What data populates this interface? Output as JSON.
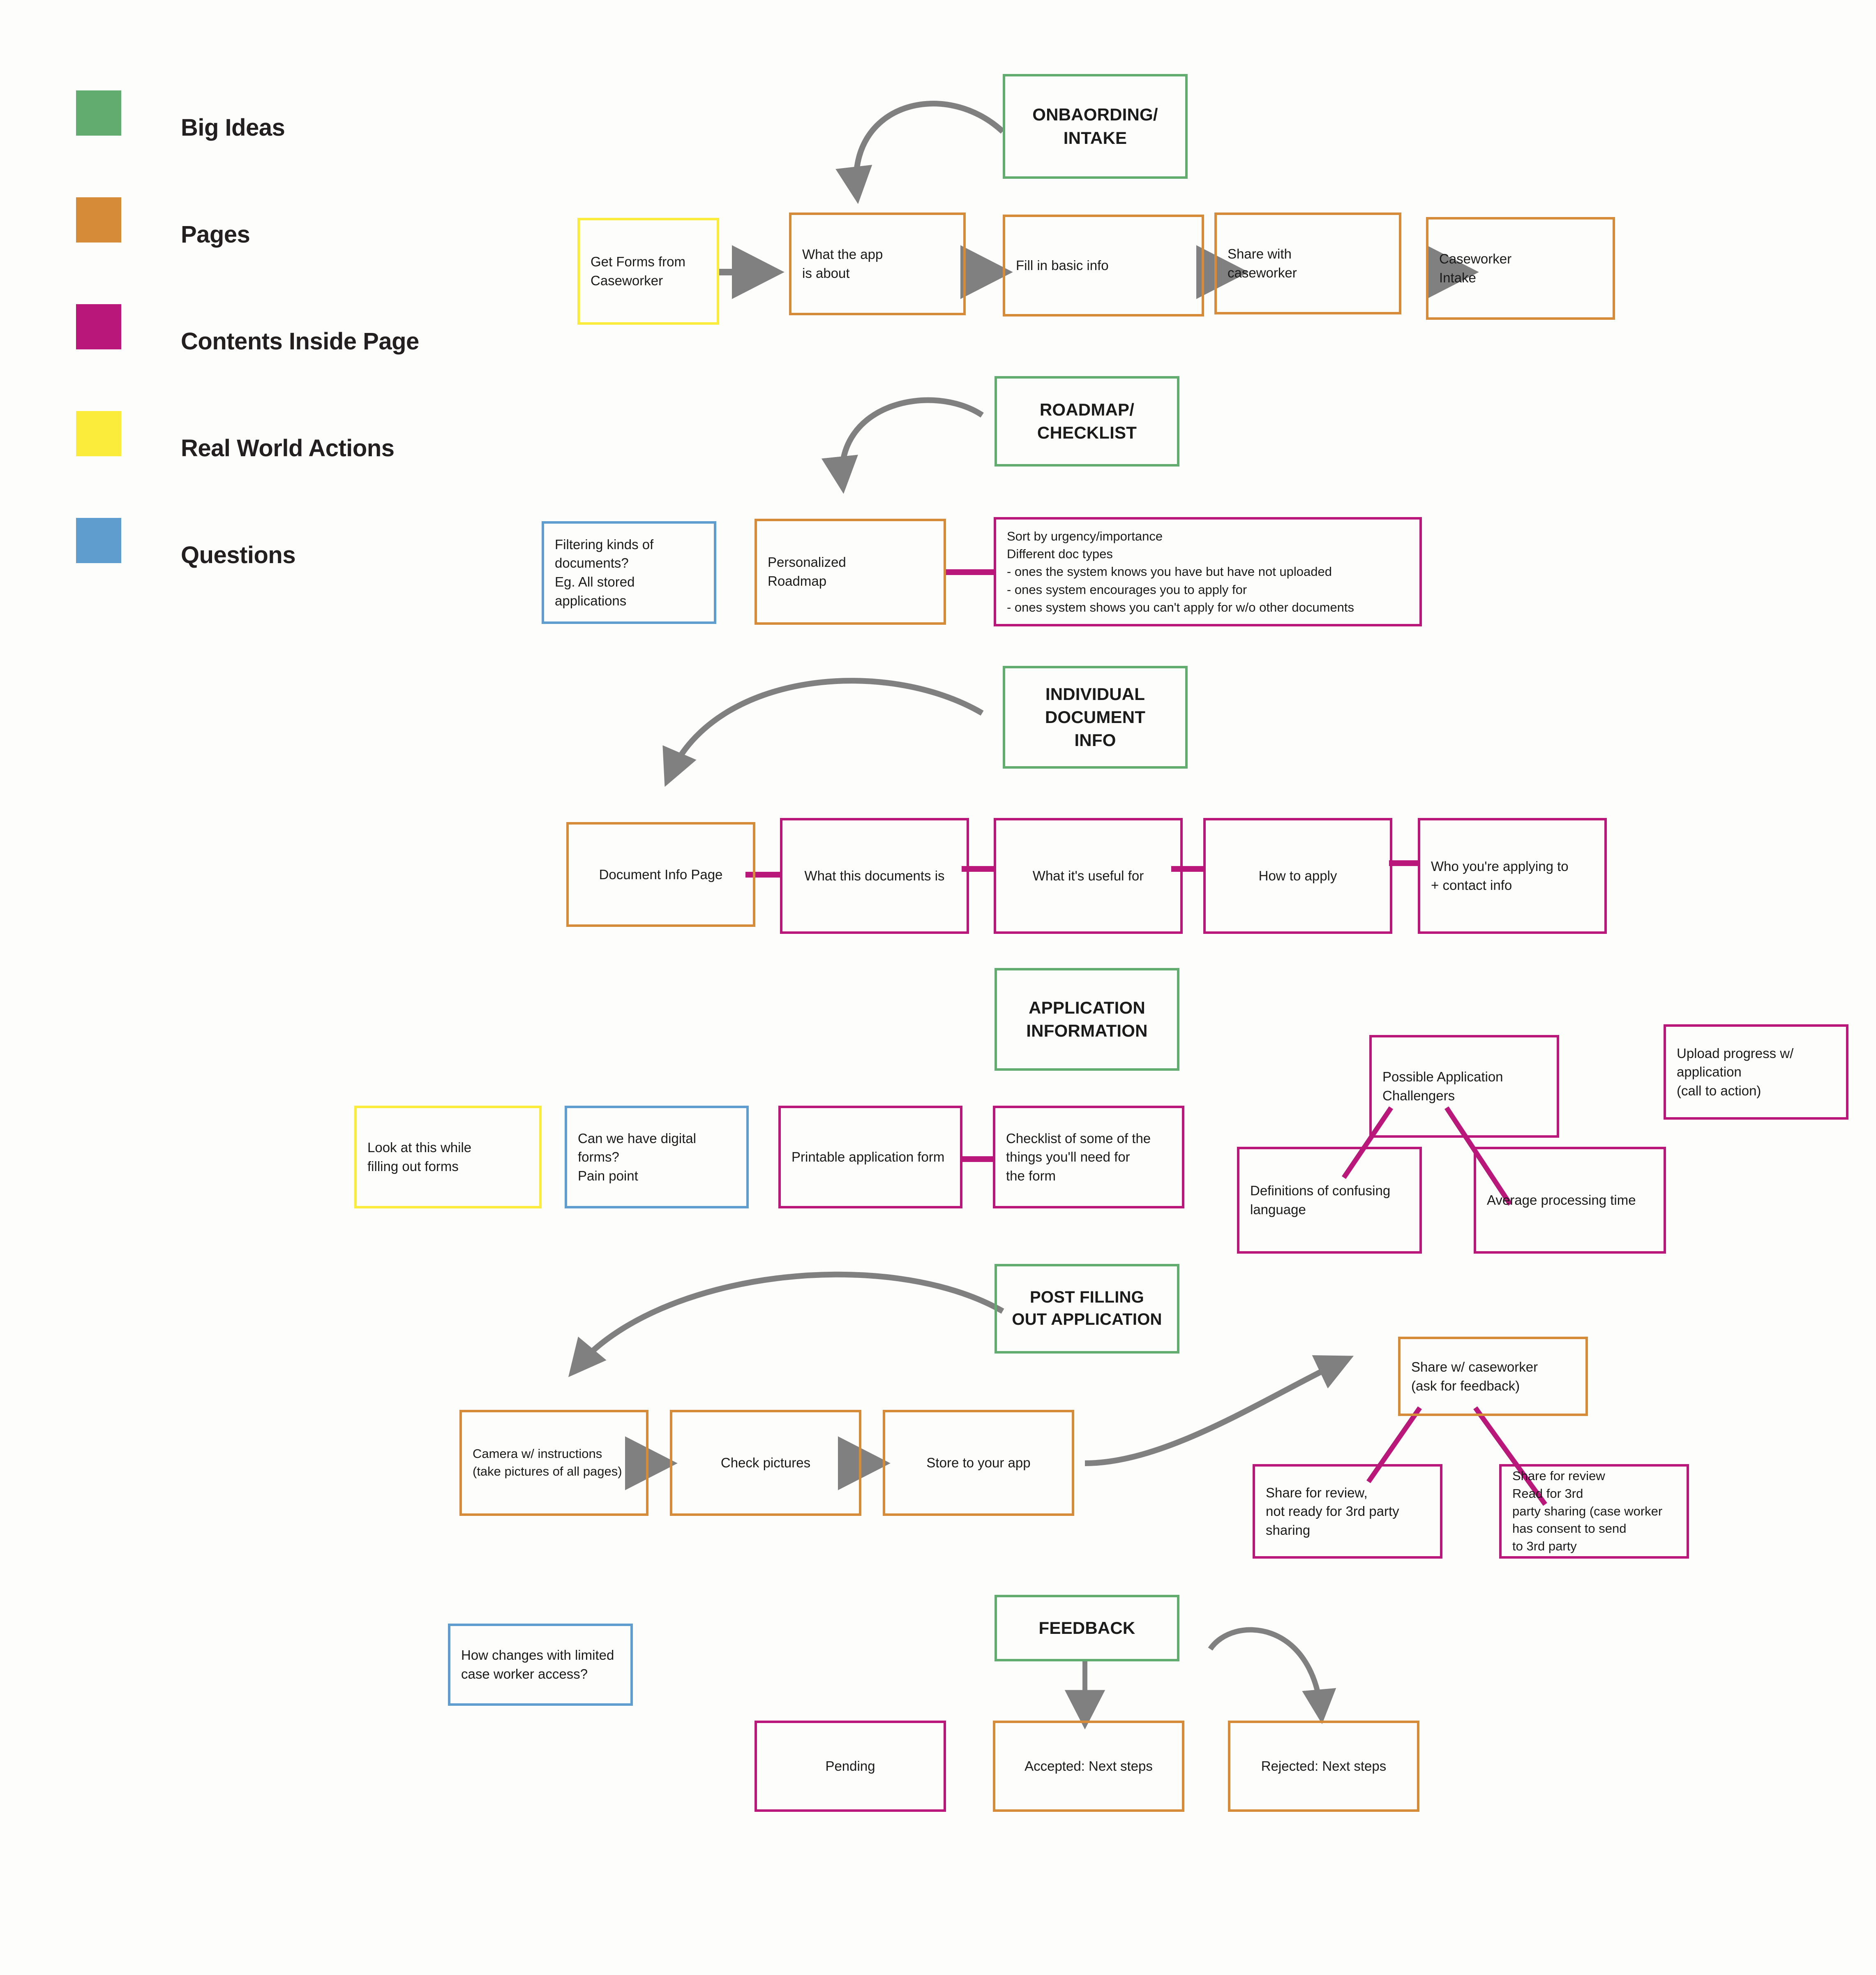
{
  "palette": {
    "green": "#63ac70",
    "orange": "#d68b38",
    "magenta": "#b91779",
    "yellow": "#fbeb3b",
    "blue": "#5e9dcd",
    "arrow_gray": "#808080",
    "text": "#1b1b1b"
  },
  "legend": {
    "items": [
      {
        "color_key": "green",
        "label": "Big Ideas"
      },
      {
        "color_key": "orange",
        "label": "Pages"
      },
      {
        "color_key": "magenta",
        "label": "Contents Inside Page"
      },
      {
        "color_key": "yellow",
        "label": "Real World Actions"
      },
      {
        "color_key": "blue",
        "label": "Questions"
      }
    ]
  },
  "sections": [
    {
      "id": "onboarding",
      "heading": "ONBAORDING/\nINTAKE",
      "nodes": [
        {
          "id": "get-forms-from-caseworker",
          "type": "yellow",
          "text": "Get Forms from\nCaseworker"
        },
        {
          "id": "what-the-app-is-about",
          "type": "orange",
          "text": "What the app\nis about"
        },
        {
          "id": "fill-in-basic-info",
          "type": "orange",
          "text": "Fill in basic info"
        },
        {
          "id": "share-with-caseworker",
          "type": "orange",
          "text": "Share with\ncaseworker"
        },
        {
          "id": "caseworker-intake",
          "type": "orange",
          "text": "Caseworker\nIntake"
        }
      ]
    },
    {
      "id": "roadmap",
      "heading": "ROADMAP/\nCHECKLIST",
      "nodes": [
        {
          "id": "filtering-kinds-of-documents",
          "type": "blue",
          "text": "Filtering kinds of\ndocuments?\nEg. All stored applications"
        },
        {
          "id": "personalized-roadmap",
          "type": "orange",
          "text": "Personalized\nRoadmap"
        },
        {
          "id": "sort-by-urgency",
          "type": "magenta",
          "text": "Sort by urgency/importance\nDifferent doc types\n- ones the system knows you have but have not uploaded\n- ones system encourages you to apply for\n- ones system shows you can't apply for w/o other documents"
        }
      ]
    },
    {
      "id": "individual-document-info",
      "heading": "INDIVIDUAL\nDOCUMENT\nINFO",
      "nodes": [
        {
          "id": "document-info-page",
          "type": "orange",
          "text": "Document Info Page"
        },
        {
          "id": "what-this-documents-is",
          "type": "magenta",
          "text": "What this documents is"
        },
        {
          "id": "what-its-useful-for",
          "type": "magenta",
          "text": "What it's useful for"
        },
        {
          "id": "how-to-apply",
          "type": "magenta",
          "text": "How to apply"
        },
        {
          "id": "who-youre-applying-to",
          "type": "magenta",
          "text": "Who you're applying to\n+ contact info"
        }
      ]
    },
    {
      "id": "application-information",
      "heading": "APPLICATION\nINFORMATION",
      "nodes": [
        {
          "id": "look-at-this-while-filling-out-forms",
          "type": "yellow",
          "text": "Look at this while\nfilling out forms"
        },
        {
          "id": "can-we-have-digital-forms",
          "type": "blue",
          "text": "Can we have digital forms?\nPain point"
        },
        {
          "id": "printable-application-form",
          "type": "magenta",
          "text": "Printable application form"
        },
        {
          "id": "checklist-of-things-for-form",
          "type": "magenta",
          "text": "Checklist of some of the\nthings you'll need for\nthe form"
        },
        {
          "id": "possible-application-challengers",
          "type": "magenta",
          "text": "Possible Application\nChallengers"
        },
        {
          "id": "definitions-of-confusing-language",
          "type": "magenta",
          "text": "Definitions of confusing\nlanguage"
        },
        {
          "id": "average-processing-time",
          "type": "magenta",
          "text": "Average processing time"
        },
        {
          "id": "upload-progress-w-application",
          "type": "magenta",
          "text": "Upload progress w/\napplication\n(call to action)"
        }
      ]
    },
    {
      "id": "post-filling-out-application",
      "heading": "POST FILLING\nOUT APPLICATION",
      "nodes": [
        {
          "id": "camera-with-instructions",
          "type": "orange",
          "text": "Camera w/ instructions\n(take pictures of all pages)"
        },
        {
          "id": "check-pictures",
          "type": "orange",
          "text": "Check pictures"
        },
        {
          "id": "store-to-your-app",
          "type": "orange",
          "text": "Store to your app"
        },
        {
          "id": "share-w-caseworker",
          "type": "orange",
          "text": "Share w/ caseworker\n(ask for feedback)"
        },
        {
          "id": "share-for-review-not-ready",
          "type": "magenta",
          "text": "Share for review,\nnot ready for 3rd party\nsharing"
        },
        {
          "id": "share-for-review-3rd-party",
          "type": "magenta",
          "text": "Share for review\nRead for 3rd\nparty sharing (case worker\nhas consent to send\n to 3rd party"
        }
      ]
    },
    {
      "id": "feedback",
      "heading": "FEEDBACK",
      "nodes": [
        {
          "id": "how-changes-with-limited-access",
          "type": "blue",
          "text": "How changes with limited\ncase worker access?"
        },
        {
          "id": "pending",
          "type": "magenta",
          "text": "Pending"
        },
        {
          "id": "accepted-next-steps",
          "type": "orange",
          "text": "Accepted: Next steps"
        },
        {
          "id": "rejected-next-steps",
          "type": "orange",
          "text": "Rejected: Next steps"
        }
      ]
    }
  ]
}
